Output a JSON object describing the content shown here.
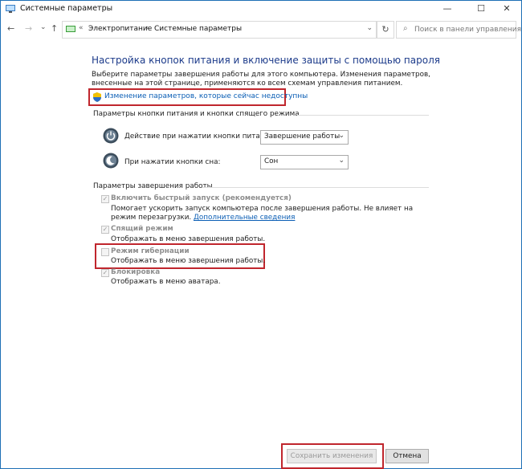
{
  "window": {
    "title": "Системные параметры",
    "controls": {
      "minimize": "—",
      "maximize": "☐",
      "close": "✕"
    }
  },
  "nav": {
    "back": "←",
    "forward": "→",
    "recent": "⌄",
    "up": "↑",
    "chevrons": "«",
    "breadcrumbs": [
      "Электропитание",
      "Системные параметры"
    ],
    "separator": "›",
    "dropdown": "⌄",
    "refresh": "↻",
    "search_placeholder": "Поиск в панели управления"
  },
  "main": {
    "heading": "Настройка кнопок питания и включение защиты с помощью пароля",
    "description": "Выберите параметры завершения работы для этого компьютера. Изменения параметров, внесенные на этой странице, применяются ко всем схемам управления питанием.",
    "uac_link": "Изменение параметров, которые сейчас недоступны"
  },
  "power_section": {
    "title": "Параметры кнопки питания и кнопки спящего режима",
    "rows": [
      {
        "label": "Действие при нажатии кнопки питания:",
        "value": "Завершение работы"
      },
      {
        "label": "При нажатии кнопки сна:",
        "value": "Сон"
      }
    ]
  },
  "shutdown_section": {
    "title": "Параметры завершения работы",
    "items": [
      {
        "label": "Включить быстрый запуск (рекомендуется)",
        "checked": true,
        "desc": "Помогает ускорить запуск компьютера после завершения работы. Не влияет на режим перезагрузки.",
        "more": "Дополнительные сведения"
      },
      {
        "label": "Спящий режим",
        "checked": true,
        "desc": "Отображать в меню завершения работы."
      },
      {
        "label": "Режим гибернации",
        "checked": false,
        "desc": "Отображать в меню завершения работы."
      },
      {
        "label": "Блокировка",
        "checked": true,
        "desc": "Отображать в меню аватара."
      }
    ]
  },
  "footer": {
    "save": "Сохранить изменения",
    "cancel": "Отмена"
  },
  "colors": {
    "heading": "#1b3a8a",
    "link": "#0b5eb5",
    "highlight_border": "#c0262d",
    "window_border": "#1f6fb5"
  }
}
